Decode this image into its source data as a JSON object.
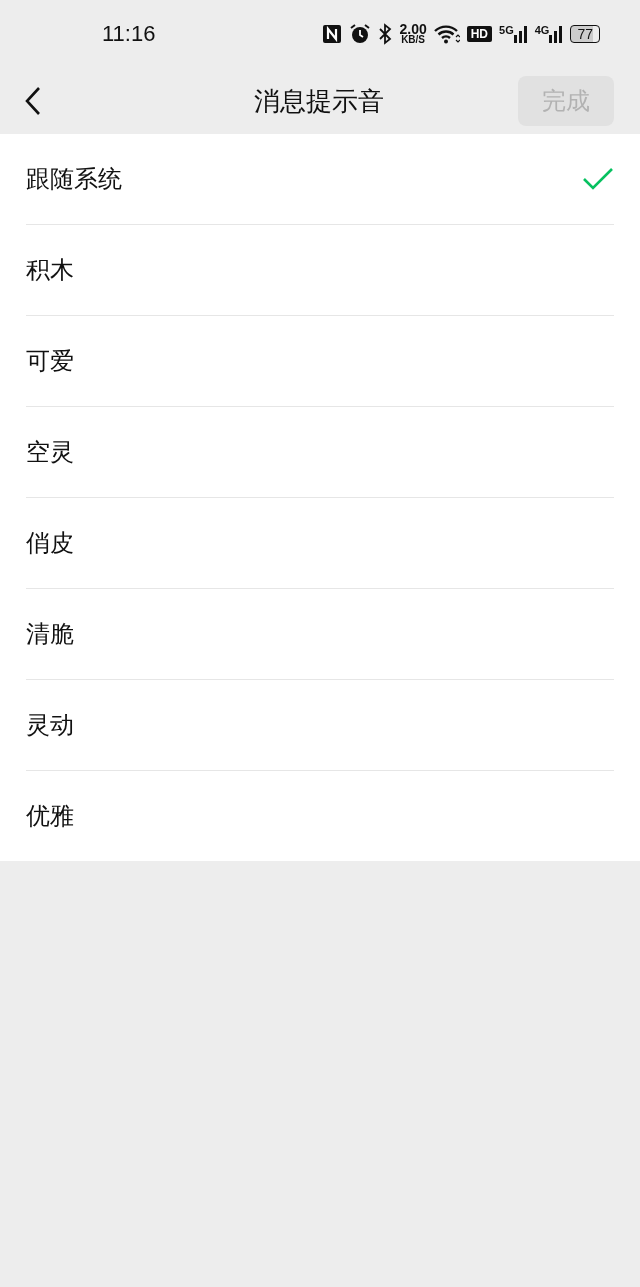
{
  "status_bar": {
    "time": "11:16",
    "speed": "2.00",
    "speed_unit": "KB/S",
    "hd": "HD",
    "sim1": "5G",
    "sim2": "4G",
    "battery": "77"
  },
  "header": {
    "title": "消息提示音",
    "done_button": {
      "label": "完成",
      "disabled": true
    }
  },
  "options": [
    {
      "label": "跟随系统",
      "selected": true
    },
    {
      "label": "积木",
      "selected": false
    },
    {
      "label": "可爱",
      "selected": false
    },
    {
      "label": "空灵",
      "selected": false
    },
    {
      "label": "俏皮",
      "selected": false
    },
    {
      "label": "清脆",
      "selected": false
    },
    {
      "label": "灵动",
      "selected": false
    },
    {
      "label": "优雅",
      "selected": false
    }
  ]
}
